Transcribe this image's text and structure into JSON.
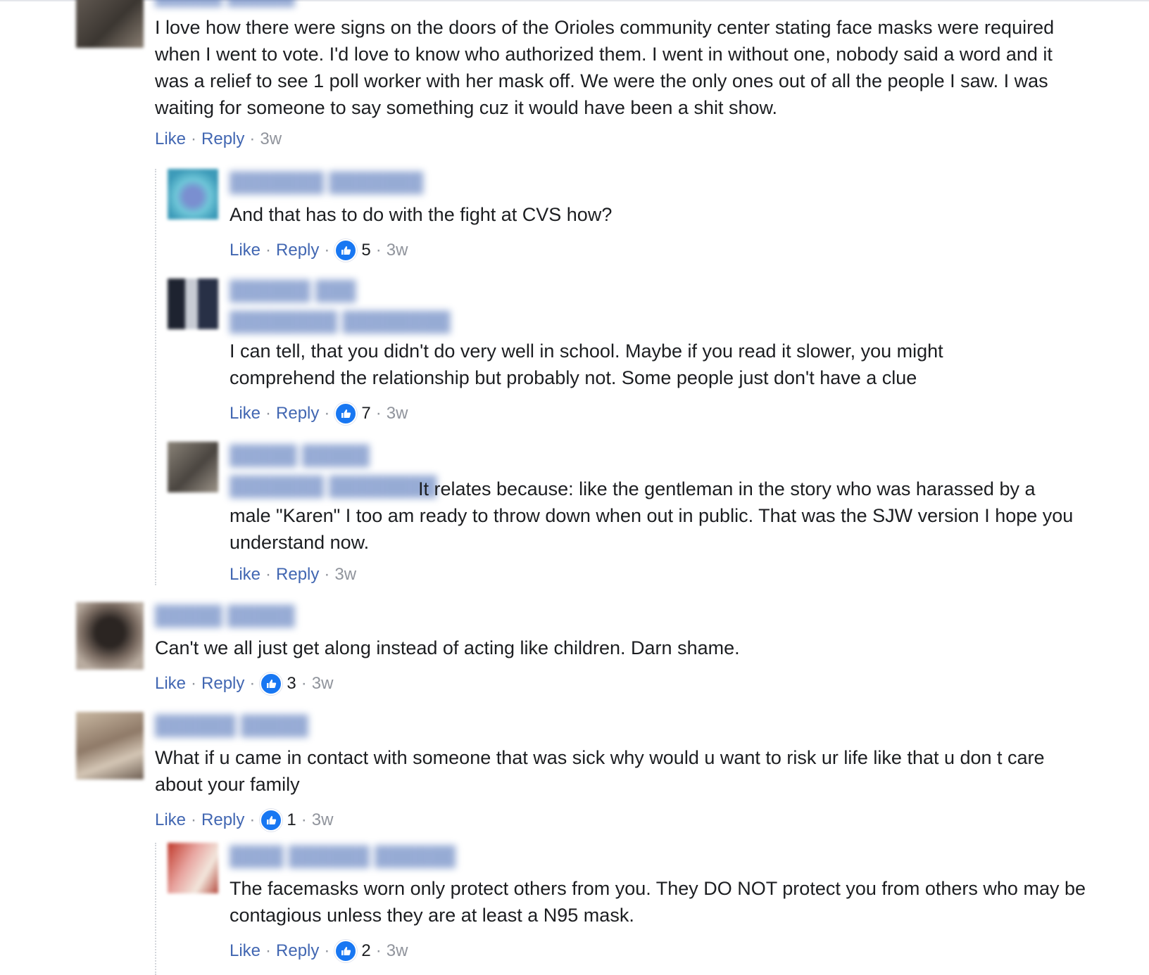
{
  "comments": [
    {
      "text": "I love how there were signs on the doors of the Orioles community center stating face masks were required when I went to vote. I'd love to know who authorized them. I went in without one, nobody said a word and it was a relief to see 1 poll worker with her mask off. We were the only ones out of all the people I saw. I was waiting for someone to say something cuz it would have been a shit show.",
      "like": "Like",
      "reply": "Reply",
      "time": "3w",
      "replies": [
        {
          "text": "And that has to do with the fight at CVS how?",
          "like": "Like",
          "reply": "Reply",
          "likes": "5",
          "time": "3w"
        },
        {
          "text": "I can tell, that you didn't do very well in school. Maybe if you read it slower, you might comprehend the relationship but probably not. Some people just don't have a clue",
          "like": "Like",
          "reply": "Reply",
          "likes": "7",
          "time": "3w"
        },
        {
          "text": "It relates because: like the gentleman in the story who was harassed by a male \"Karen\" I too am ready to throw down when out in public. That was the SJW version I hope you understand now.",
          "like": "Like",
          "reply": "Reply",
          "time": "3w"
        }
      ]
    },
    {
      "text": "Can't we all just get along instead of acting like children. Darn shame.",
      "like": "Like",
      "reply": "Reply",
      "likes": "3",
      "time": "3w"
    },
    {
      "text": "What if u came in contact with someone that was sick why would u want to risk ur life like that u don t care about your family",
      "like": "Like",
      "reply": "Reply",
      "likes": "1",
      "time": "3w",
      "replies": [
        {
          "text": "The facemasks worn only protect others from you. They DO NOT protect you from others who may be contagious unless they are at least a N95 mask.",
          "like": "Like",
          "reply": "Reply",
          "likes": "2",
          "time": "3w"
        }
      ]
    }
  ],
  "colors": {
    "link": "#4267b2",
    "meta": "#90949c",
    "text": "#1c1e21",
    "like_badge": "#1877f2"
  },
  "icons": {
    "like_badge": "thumbs-up-icon"
  }
}
